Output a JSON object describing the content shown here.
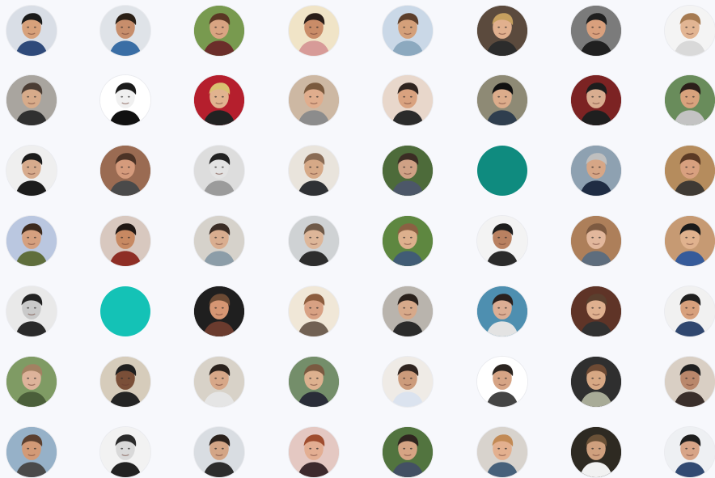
{
  "avatars": [
    [
      {
        "bg": "#d9dee6",
        "skin": "#d7a17b",
        "hair": "#1a1a1a",
        "shirt": "#2f4a7a",
        "icon": "person-avatar"
      },
      {
        "bg": "#dfe3e8",
        "skin": "#c78e6c",
        "hair": "#2a1f16",
        "shirt": "#3a6ea5",
        "icon": "person-avatar"
      },
      {
        "bg": "#789a4f",
        "skin": "#d9a482",
        "hair": "#5a3724",
        "shirt": "#6b2e2a",
        "icon": "person-avatar"
      },
      {
        "bg": "#f0e4c7",
        "skin": "#c98c68",
        "hair": "#2a1e19",
        "shirt": "#d79b98",
        "icon": "person-avatar"
      },
      {
        "bg": "#cad8e7",
        "skin": "#d4a07a",
        "hair": "#5c3f2c",
        "shirt": "#8ca9bf",
        "icon": "person-avatar"
      },
      {
        "bg": "#5b4a3d",
        "skin": "#e1b08e",
        "hair": "#c6a05f",
        "shirt": "#2c2c2c",
        "icon": "person-avatar"
      },
      {
        "bg": "#7b7b7b",
        "skin": "#d9a07d",
        "hair": "#1f1f1f",
        "shirt": "#202020",
        "icon": "person-avatar"
      },
      {
        "bg": "#f4f4f4",
        "skin": "#e2b593",
        "hair": "#a67b52",
        "shirt": "#d9d9d9",
        "icon": "person-avatar"
      }
    ],
    [
      {
        "bg": "#a9a59f",
        "skin": "#d7ab8a",
        "hair": "#4b3d34",
        "shirt": "#303030",
        "icon": "person-avatar"
      },
      {
        "bg": "#ffffff",
        "skin": "#f0f0f0",
        "hair": "#1b1b1b",
        "shirt": "#111111",
        "icon": "person-avatar"
      },
      {
        "bg": "#b51f2d",
        "skin": "#e1b38f",
        "hair": "#d9c171",
        "shirt": "#222222",
        "icon": "person-avatar"
      },
      {
        "bg": "#cdb8a3",
        "skin": "#e0ad8d",
        "hair": "#7a5a3e",
        "shirt": "#8c8c8c",
        "icon": "person-avatar"
      },
      {
        "bg": "#e8d7cb",
        "skin": "#d9a27f",
        "hair": "#2f241f",
        "shirt": "#2b2b2b",
        "icon": "person-avatar"
      },
      {
        "bg": "#8e8a75",
        "skin": "#dcac8b",
        "hair": "#111111",
        "shirt": "#2f3e4e",
        "icon": "person-avatar"
      },
      {
        "bg": "#7c2323",
        "skin": "#d9ad90",
        "hair": "#1d1d1d",
        "shirt": "#1f1f1f",
        "icon": "person-avatar"
      },
      {
        "bg": "#698c5b",
        "skin": "#d8a27d",
        "hair": "#2b1f19",
        "shirt": "#c3c3c3",
        "icon": "person-avatar"
      }
    ],
    [
      {
        "bg": "#efefef",
        "skin": "#d7ab8d",
        "hair": "#1b1b1b",
        "shirt": "#1c1c1c",
        "icon": "person-avatar"
      },
      {
        "bg": "#9a6b52",
        "skin": "#d59b7c",
        "hair": "#4b3326",
        "shirt": "#4a4a4a",
        "icon": "person-avatar"
      },
      {
        "bg": "#dddddd",
        "skin": "#e3e3e3",
        "hair": "#222222",
        "shirt": "#9b9b9b",
        "icon": "person-avatar"
      },
      {
        "bg": "#e9e4dc",
        "skin": "#d6a987",
        "hair": "#8a6c55",
        "shirt": "#2f3134",
        "icon": "person-avatar"
      },
      {
        "bg": "#4d6b3a",
        "skin": "#cfa185",
        "hair": "#3b2d24",
        "shirt": "#4c5768",
        "icon": "person-avatar"
      },
      {
        "bg": "#0f8b7f",
        "solid": true,
        "icon": "placeholder-avatar"
      },
      {
        "bg": "#8ea1b1",
        "skin": "#d6a686",
        "hair": "#bfbfbf",
        "shirt": "#1f2c43",
        "icon": "person-avatar"
      },
      {
        "bg": "#b58c5d",
        "skin": "#d8a07f",
        "hair": "#5b3a25",
        "shirt": "#3f3a34",
        "icon": "person-avatar"
      }
    ],
    [
      {
        "bg": "#bac7e0",
        "skin": "#d5a07f",
        "hair": "#3c2a1e",
        "shirt": "#5f6e3c",
        "icon": "person-avatar"
      },
      {
        "bg": "#d8c8bf",
        "skin": "#c78962",
        "hair": "#1f1714",
        "shirt": "#8e2e25",
        "icon": "person-avatar"
      },
      {
        "bg": "#d6d2cb",
        "skin": "#d9ad8f",
        "hair": "#3b2d25",
        "shirt": "#8c9da8",
        "icon": "person-avatar"
      },
      {
        "bg": "#cfd2d4",
        "skin": "#ddb699",
        "hair": "#6f5a49",
        "shirt": "#2d2d2d",
        "icon": "person-avatar"
      },
      {
        "bg": "#5e8740",
        "skin": "#ddb08d",
        "hair": "#8b6143",
        "shirt": "#415c75",
        "icon": "person-avatar"
      },
      {
        "bg": "#f3f3f3",
        "skin": "#b98161",
        "hair": "#1d1d1d",
        "shirt": "#2b2b2b",
        "icon": "person-avatar"
      },
      {
        "bg": "#ad7f5a",
        "skin": "#e2b79c",
        "hair": "#7d5a41",
        "shirt": "#5e6d7d",
        "icon": "person-avatar"
      },
      {
        "bg": "#c69a73",
        "skin": "#e0b28e",
        "hair": "#1a1a1a",
        "shirt": "#365b9a",
        "icon": "person-avatar"
      }
    ],
    [
      {
        "bg": "#e9e9e9",
        "skin": "#c9c9c9",
        "hair": "#222222",
        "shirt": "#2a2a2a",
        "icon": "person-avatar"
      },
      {
        "bg": "#14c2b6",
        "solid": true,
        "icon": "placeholder-avatar"
      },
      {
        "bg": "#1f1f1f",
        "skin": "#d69673",
        "hair": "#6b4a34",
        "shirt": "#6a3b2e",
        "icon": "person-avatar"
      },
      {
        "bg": "#f0e7d7",
        "skin": "#d8a183",
        "hair": "#8c5d3e",
        "shirt": "#716153",
        "icon": "person-avatar"
      },
      {
        "bg": "#b9b4ad",
        "skin": "#d7a98a",
        "hair": "#2a211c",
        "shirt": "#2b2b2b",
        "icon": "person-avatar"
      },
      {
        "bg": "#4e8fb0",
        "skin": "#dcae94",
        "hair": "#2a211e",
        "shirt": "#e3e3e3",
        "icon": "person-avatar"
      },
      {
        "bg": "#5f3427",
        "skin": "#dfb08f",
        "hair": "#5a3f2e",
        "shirt": "#313131",
        "icon": "person-avatar"
      },
      {
        "bg": "#f1f1f1",
        "skin": "#d7a07c",
        "hair": "#1f1f1f",
        "shirt": "#30476f",
        "icon": "person-avatar"
      }
    ],
    [
      {
        "bg": "#7f9b64",
        "skin": "#ddb39a",
        "hair": "#a38162",
        "shirt": "#4b5f3a",
        "icon": "person-avatar"
      },
      {
        "bg": "#d6ccbb",
        "skin": "#7a4f38",
        "hair": "#1f1f1f",
        "shirt": "#242424",
        "icon": "person-avatar"
      },
      {
        "bg": "#d8d2c8",
        "skin": "#d7a788",
        "hair": "#2a211c",
        "shirt": "#e5e5e5",
        "icon": "person-avatar"
      },
      {
        "bg": "#748e6a",
        "skin": "#ddb18f",
        "hair": "#7a5a41",
        "shirt": "#2a2d38",
        "icon": "person-avatar"
      },
      {
        "bg": "#efebe6",
        "skin": "#cc9b7b",
        "hair": "#2f241f",
        "shirt": "#dbe3ef",
        "icon": "person-avatar"
      },
      {
        "bg": "#ffffff",
        "skin": "#d6a485",
        "hair": "#2b2420",
        "shirt": "#444444",
        "icon": "person-avatar"
      },
      {
        "bg": "#2f2f2f",
        "skin": "#d7a884",
        "hair": "#6d4a34",
        "shirt": "#a8ab97",
        "icon": "person-avatar"
      },
      {
        "bg": "#d9cfc4",
        "skin": "#b9876b",
        "hair": "#1f1f1f",
        "shirt": "#3a2f2b",
        "icon": "person-avatar"
      }
    ],
    [
      {
        "bg": "#96b1c8",
        "skin": "#d29a77",
        "hair": "#5b4030",
        "shirt": "#4a4a4a",
        "icon": "person-avatar"
      },
      {
        "bg": "#f2f2f2",
        "skin": "#d9d9d9",
        "hair": "#2a2a2a",
        "shirt": "#222222",
        "icon": "person-avatar"
      },
      {
        "bg": "#d9dde2",
        "skin": "#d3a586",
        "hair": "#2a211c",
        "shirt": "#2d2d2d",
        "icon": "person-avatar"
      },
      {
        "bg": "#e4c8c2",
        "skin": "#e3ae92",
        "hair": "#9f4d2f",
        "shirt": "#3d2a2d",
        "icon": "person-avatar"
      },
      {
        "bg": "#52743f",
        "skin": "#d6a484",
        "hair": "#2f241f",
        "shirt": "#435063",
        "icon": "person-avatar"
      },
      {
        "bg": "#d8d3cd",
        "skin": "#e3b08f",
        "hair": "#c28a55",
        "shirt": "#47617b",
        "icon": "person-avatar"
      },
      {
        "bg": "#2e2a22",
        "skin": "#cfa07e",
        "hair": "#6a5137",
        "shirt": "#f1f1f1",
        "icon": "person-avatar"
      },
      {
        "bg": "#eef0f3",
        "skin": "#d7a487",
        "hair": "#1d1d1d",
        "shirt": "#324a72",
        "icon": "person-avatar"
      }
    ]
  ]
}
